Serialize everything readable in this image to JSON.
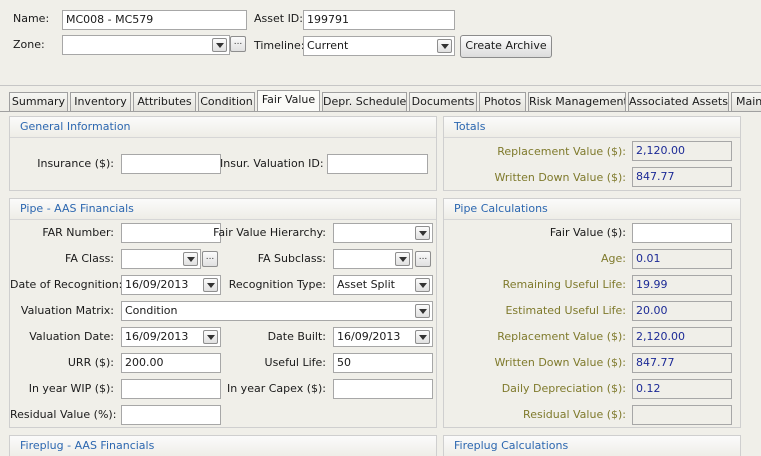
{
  "header": {
    "name_label": "Name:",
    "name_value": "MC008 - MC579",
    "asset_id_label": "Asset ID:",
    "asset_id_value": "199791",
    "zone_label": "Zone:",
    "zone_value": "",
    "timeline_label": "Timeline:",
    "timeline_value": "Current",
    "create_archive_label": "Create Archive",
    "ellipsis": "..."
  },
  "tabs": [
    {
      "label": "Summary"
    },
    {
      "label": "Inventory"
    },
    {
      "label": "Attributes"
    },
    {
      "label": "Condition"
    },
    {
      "label": "Fair Value",
      "active": true
    },
    {
      "label": "Depr. Schedule"
    },
    {
      "label": "Documents"
    },
    {
      "label": "Photos"
    },
    {
      "label": "Risk Management"
    },
    {
      "label": "Associated Assets"
    },
    {
      "label": "Main"
    }
  ],
  "general_info": {
    "title": "General Information",
    "insurance_label": "Insurance ($):",
    "insurance_value": "",
    "insur_valuation_id_label": "Insur. Valuation ID:",
    "insur_valuation_id_value": ""
  },
  "totals": {
    "title": "Totals",
    "replacement_value_label": "Replacement Value ($):",
    "replacement_value": "2,120.00",
    "written_down_value_label": "Written Down Value ($):",
    "written_down_value": "847.77"
  },
  "pipe_financials": {
    "title": "Pipe - AAS Financials",
    "far_number_label": "FAR Number:",
    "far_number_value": "",
    "fair_value_hierarchy_label": "Fair Value Hierarchy:",
    "fair_value_hierarchy_value": "",
    "fa_class_label": "FA Class:",
    "fa_class_value": "",
    "fa_subclass_label": "FA Subclass:",
    "fa_subclass_value": "",
    "date_of_recognition_label": "Date of Recognition:",
    "date_of_recognition_value": "16/09/2013",
    "recognition_type_label": "Recognition Type:",
    "recognition_type_value": "Asset Split",
    "valuation_matrix_label": "Valuation Matrix:",
    "valuation_matrix_value": "Condition",
    "valuation_date_label": "Valuation Date:",
    "valuation_date_value": "16/09/2013",
    "date_built_label": "Date Built:",
    "date_built_value": "16/09/2013",
    "urr_label": "URR ($):",
    "urr_value": "200.00",
    "useful_life_label": "Useful Life:",
    "useful_life_value": "50",
    "in_year_wip_label": "In year WIP ($):",
    "in_year_wip_value": "",
    "in_year_capex_label": "In year Capex ($):",
    "in_year_capex_value": "",
    "residual_value_label": "Residual Value (%):",
    "residual_value_value": ""
  },
  "pipe_calculations": {
    "title": "Pipe Calculations",
    "fair_value_label": "Fair Value ($):",
    "fair_value_value": "",
    "age_label": "Age:",
    "age_value": "0.01",
    "remaining_useful_life_label": "Remaining Useful Life:",
    "remaining_useful_life_value": "19.99",
    "estimated_useful_life_label": "Estimated Useful Life:",
    "estimated_useful_life_value": "20.00",
    "replacement_value_label": "Replacement Value ($):",
    "replacement_value_value": "2,120.00",
    "written_down_value_label": "Written Down Value ($):",
    "written_down_value_value": "847.77",
    "daily_depreciation_label": "Daily Depreciation ($):",
    "daily_depreciation_value": "0.12",
    "residual_value_label": "Residual Value ($):",
    "residual_value_value": ""
  },
  "fireplug_financials": {
    "title": "Fireplug - AAS Financials"
  },
  "fireplug_calculations": {
    "title": "Fireplug Calculations"
  },
  "colors": {
    "section_title": "#2c67b0",
    "readonly_label": "#7f7a2c",
    "readonly_value": "#1c2a96",
    "background": "#f0efe9"
  },
  "icons": {
    "dropdown": "chevron-down-icon",
    "ellipsis": "ellipsis-icon"
  }
}
